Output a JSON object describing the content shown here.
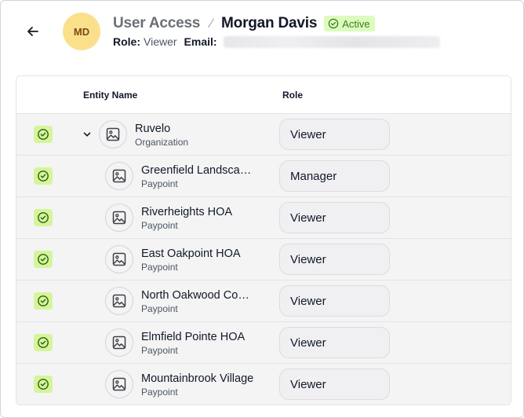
{
  "header": {
    "back_icon": "arrow-left-icon",
    "avatar_initials": "MD",
    "breadcrumb_parent": "User Access",
    "breadcrumb_separator": "⁄",
    "user_name": "Morgan Davis",
    "status": "Active",
    "status_icon": "check-circle-icon",
    "role_label": "Role:",
    "role_value": "Viewer",
    "email_label": "Email:",
    "colors": {
      "avatar_bg": "#fbe08c",
      "badge_bg": "#dcfcbe",
      "badge_text": "#3f7a1a"
    }
  },
  "table": {
    "columns": {
      "entity": "Entity Name",
      "role": "Role"
    },
    "rows": [
      {
        "name": "Ruvelo",
        "type": "Organization",
        "role": "Viewer",
        "selected": true,
        "expanded": true,
        "level": 0
      },
      {
        "name": "Greenfield Landscaping",
        "type": "Paypoint",
        "role": "Manager",
        "selected": true,
        "level": 1
      },
      {
        "name": "Riverheights HOA",
        "type": "Paypoint",
        "role": "Viewer",
        "selected": true,
        "level": 1
      },
      {
        "name": "East Oakpoint HOA",
        "type": "Paypoint",
        "role": "Viewer",
        "selected": true,
        "level": 1
      },
      {
        "name": "North Oakwood Commons",
        "type": "Paypoint",
        "role": "Viewer",
        "selected": true,
        "level": 1
      },
      {
        "name": "Elmfield Pointe HOA",
        "type": "Paypoint",
        "role": "Viewer",
        "selected": true,
        "level": 1
      },
      {
        "name": "Mountainbrook Village",
        "type": "Paypoint",
        "role": "Viewer",
        "selected": true,
        "level": 1
      }
    ],
    "icons": {
      "select": "check-circle-icon",
      "expand": "chevron-down-icon",
      "entity": "image-placeholder-icon"
    },
    "colors": {
      "checkbox_bg": "#d4f59a",
      "check_stroke": "#2f5e10"
    }
  }
}
